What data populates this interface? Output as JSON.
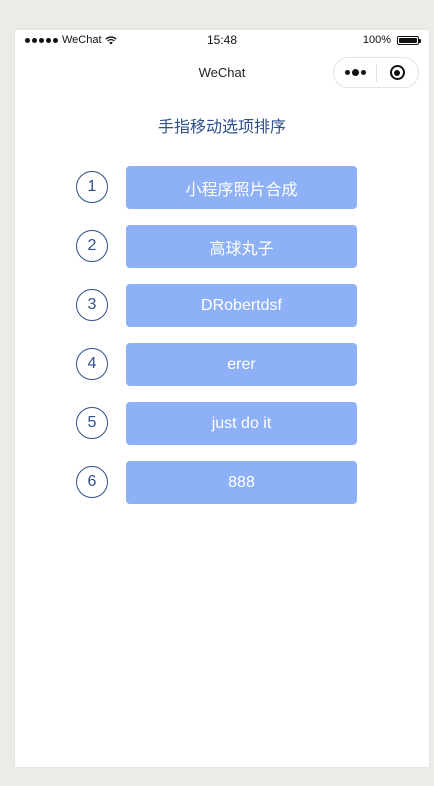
{
  "status_bar": {
    "carrier": "WeChat",
    "time": "15:48",
    "battery": "100%"
  },
  "nav": {
    "title": "WeChat"
  },
  "page": {
    "title": "手指移动选项排序"
  },
  "items": [
    {
      "index": "1",
      "label": "小程序照片合成"
    },
    {
      "index": "2",
      "label": "高球丸子"
    },
    {
      "index": "3",
      "label": "DRobertdsf"
    },
    {
      "index": "4",
      "label": "erer"
    },
    {
      "index": "5",
      "label": "just do it"
    },
    {
      "index": "6",
      "label": "888"
    }
  ],
  "colors": {
    "item_bg": "#8eb0f7",
    "accent": "#2e4f8a"
  }
}
